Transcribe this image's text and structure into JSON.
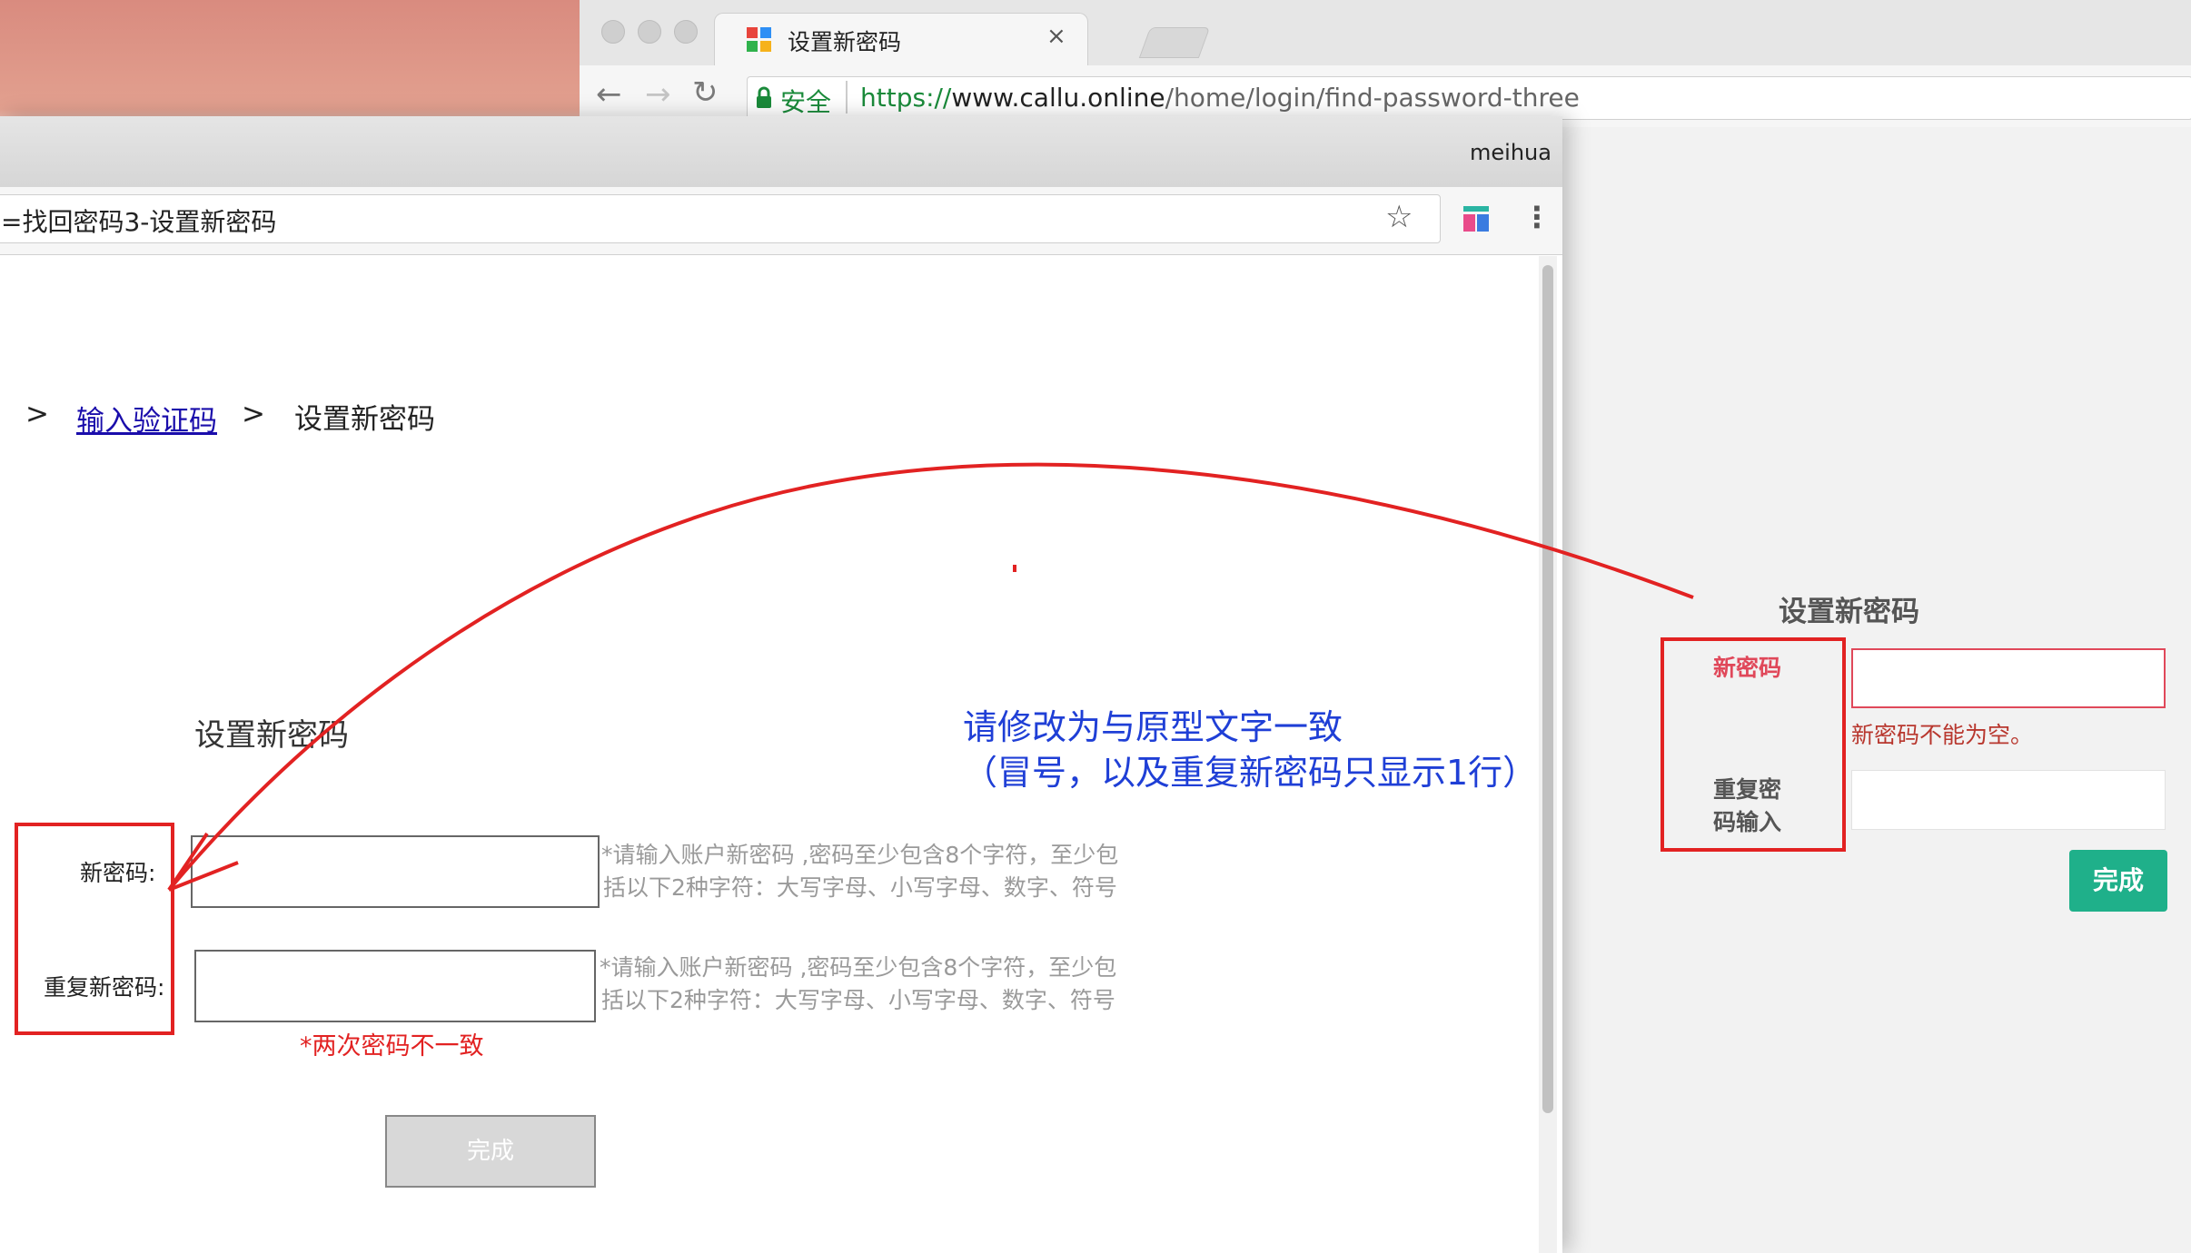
{
  "back_window": {
    "tab_title": "设置新密码",
    "tab_close": "×",
    "secure_label": "安全",
    "url_scheme": "https://",
    "url_host": "www.callu.online",
    "url_path": "/home/login/find-password-three",
    "content": {
      "heading": "设置新密码",
      "new_password_label": "新密码",
      "new_password_error": "新密码不能为空。",
      "repeat_label_line1": "重复密",
      "repeat_label_line2": "码输入",
      "submit_label": "完成"
    }
  },
  "front_window": {
    "profile_name": "meihua",
    "address_text": "=找回密码3-设置新密码",
    "breadcrumb": {
      "sep1": ">",
      "link": "输入验证码",
      "sep2": ">",
      "current": "设置新密码"
    },
    "form": {
      "title": "设置新密码",
      "new_password_label": "新密码:",
      "new_password_hint_line1": "*请输入账户新密码 ,密码至少包含8个字符，至少包",
      "new_password_hint_line2": "括以下2种字符：大写字母、小写字母、数字、符号",
      "repeat_password_label": "重复新密码:",
      "repeat_password_hint_line1": "*请输入账户新密码 ,密码至少包含8个字符，至少包",
      "repeat_password_hint_line2": "括以下2种字符：大写字母、小写字母、数字、符号",
      "mismatch_error": "*两次密码不一致",
      "submit_label": "完成"
    }
  },
  "annotation": {
    "line1": "请修改为与原型文字一致",
    "line2": "（冒号，以及重复新密码只显示1行）",
    "color": "#1f3fd6",
    "mark_color": "#e22222"
  },
  "colors": {
    "secure_green": "#1a8a3a",
    "link_blue": "#1a0dab",
    "error_red": "#e22222",
    "back_label_red": "#e0485a",
    "back_button_teal": "#1fb08a"
  }
}
